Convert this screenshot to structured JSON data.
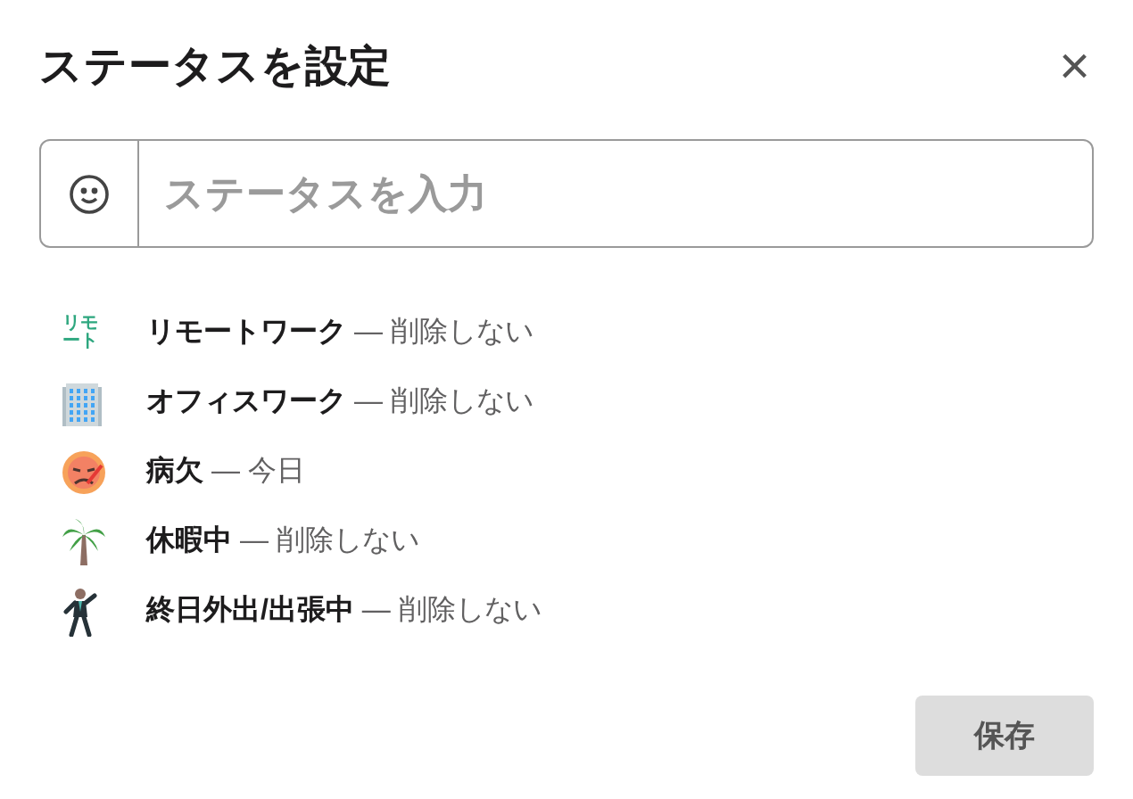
{
  "dialog": {
    "title": "ステータスを設定",
    "close": "×"
  },
  "status_field": {
    "placeholder": "ステータスを入力"
  },
  "presets": [
    {
      "kind": "text",
      "icon_text": "リモート",
      "label": "**リモートワーク** — 削除しない"
    },
    {
      "kind": "building",
      "label": "**オフィスワーク** — 削除しない"
    },
    {
      "kind": "sick",
      "label": "**病欠** — 今日"
    },
    {
      "kind": "palm",
      "label": "**休暇中** — 削除しない"
    },
    {
      "kind": "walker",
      "label": "**終日外出/出張中** — 削除しない"
    }
  ],
  "buttons": {
    "save": "保存"
  }
}
